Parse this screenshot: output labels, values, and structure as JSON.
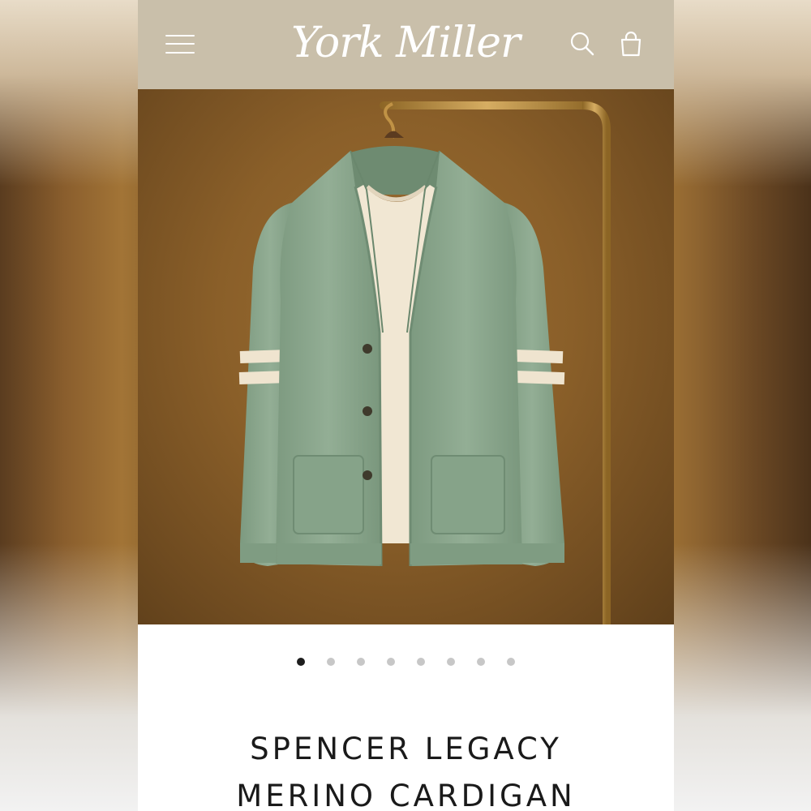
{
  "header": {
    "brand": "York Miller",
    "menu_icon": "hamburger-menu-icon",
    "search_icon": "search-icon",
    "cart_icon": "shopping-bag-icon",
    "background_color": "#c9bfaa"
  },
  "gallery": {
    "image_alt": "green merino cardigan with cream sleeve stripes hanging on a brass rail over a cream crew-neck tee",
    "total_images": 8,
    "active_index": 0
  },
  "product": {
    "title_line1": "SPENCER LEGACY",
    "title_line2": "MERINO CARDIGAN"
  },
  "colors": {
    "cardigan": "#8aa58d",
    "stripe": "#efe4cf",
    "backdrop": "#8a5f29",
    "brass": "#b68a44"
  }
}
